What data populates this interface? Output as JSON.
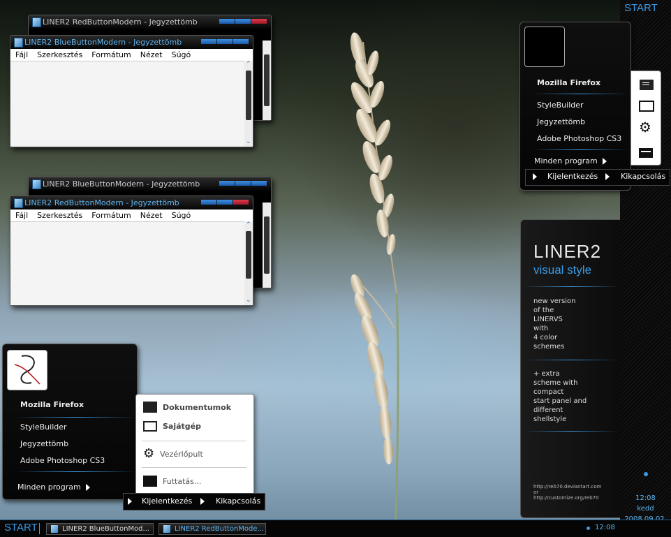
{
  "windows": [
    {
      "title": "LINER2 RedButtonModern - Jegyzettömb"
    },
    {
      "title": "LINER2 BlueButtonModern - Jegyzettömb"
    },
    {
      "title": "LINER2 BlueButtonModern - Jegyzettömb"
    },
    {
      "title": "LINER2 RedButtonModern - Jegyzettömb"
    }
  ],
  "notepad_menu": [
    "Fájl",
    "Szerkesztés",
    "Formátum",
    "Nézet",
    "Súgó"
  ],
  "start_top_label": "START",
  "top_start_menu": {
    "pinned": "Mozilla Firefox",
    "items": [
      "StyleBuilder",
      "Jegyzettömb",
      "Adobe Photoshop CS3"
    ],
    "all_programs": "Minden program",
    "logoff": "Kijelentkezés",
    "shutdown": "Kikapcsolás",
    "side_icons": [
      "documents-icon",
      "monitor-icon",
      "gear-icon",
      "run-icon"
    ]
  },
  "bottom_start_menu": {
    "pinned": "Mozilla Firefox",
    "items": [
      "StyleBuilder",
      "Jegyzettömb",
      "Adobe Photoshop CS3"
    ],
    "all_programs": "Minden program",
    "logoff": "Kijelentkezés",
    "shutdown": "Kikapcsolás",
    "right_items": [
      "Dokumentumok",
      "Sajátgép",
      "Vezérlőpult",
      "Futtatás..."
    ]
  },
  "liner_panel": {
    "title": "LINER2",
    "subtitle": "visual style",
    "text1": [
      "new version",
      "of the",
      "LINERVS",
      "with",
      "4 color",
      "schemes"
    ],
    "text2": [
      "+ extra",
      "scheme with",
      "compact",
      "start panel and",
      "different",
      "shellstyle"
    ],
    "links": [
      "http://reb70.deviantart.com",
      "or",
      "http://customize.org/reb70"
    ]
  },
  "clock_side": {
    "time": "12:08",
    "day": "kedd",
    "date": "2008.09.02."
  },
  "taskbar": {
    "start": "START",
    "buttons": [
      "LINER2 BlueButtonMod...",
      "LINER2 RedButtonMode..."
    ],
    "time": "12:08"
  },
  "colors": {
    "accent": "#3b9be6",
    "title_blue": "#5fb4f0",
    "close_red": "#e03a4a"
  }
}
